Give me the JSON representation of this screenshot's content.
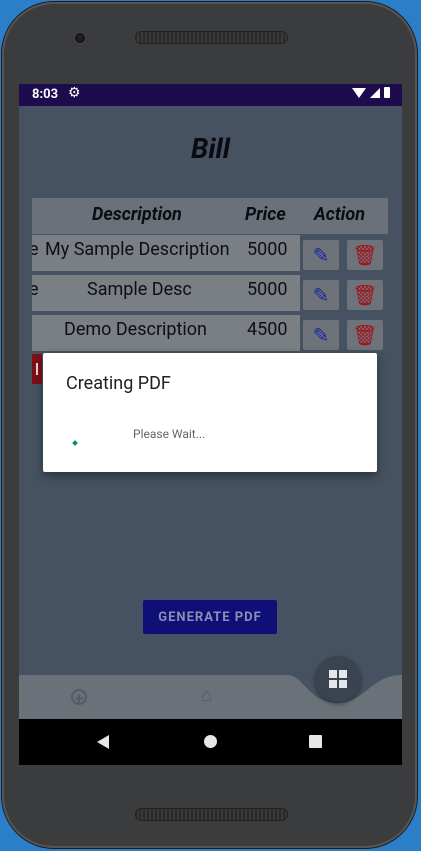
{
  "status": {
    "time": "8:03"
  },
  "app": {
    "title": "Bill"
  },
  "table": {
    "headers": [
      "Description",
      "Price",
      "Action"
    ],
    "rows": [
      {
        "prefix": "e",
        "description": "My Sample Description",
        "price": "5000"
      },
      {
        "prefix": "e",
        "description": "Sample Desc",
        "price": "5000"
      },
      {
        "prefix": "",
        "description": "Demo Description",
        "price": "4500"
      }
    ]
  },
  "generate_button": {
    "label": "GENERATE PDF"
  },
  "dialog": {
    "title": "Creating PDF",
    "message": "Please Wait..."
  },
  "icons": {
    "settings": "gear-icon",
    "edit": "pencil-icon",
    "delete": "trash-icon",
    "add": "plus-circle-icon",
    "home": "home-icon",
    "grid": "grid-icon"
  },
  "colors": {
    "statusbar": "#1d0b4c",
    "accent_button": "#0f1077",
    "edit_icon": "#1a2a9c",
    "delete_icon": "#a3101a",
    "spinner": "#0b8a6f"
  }
}
